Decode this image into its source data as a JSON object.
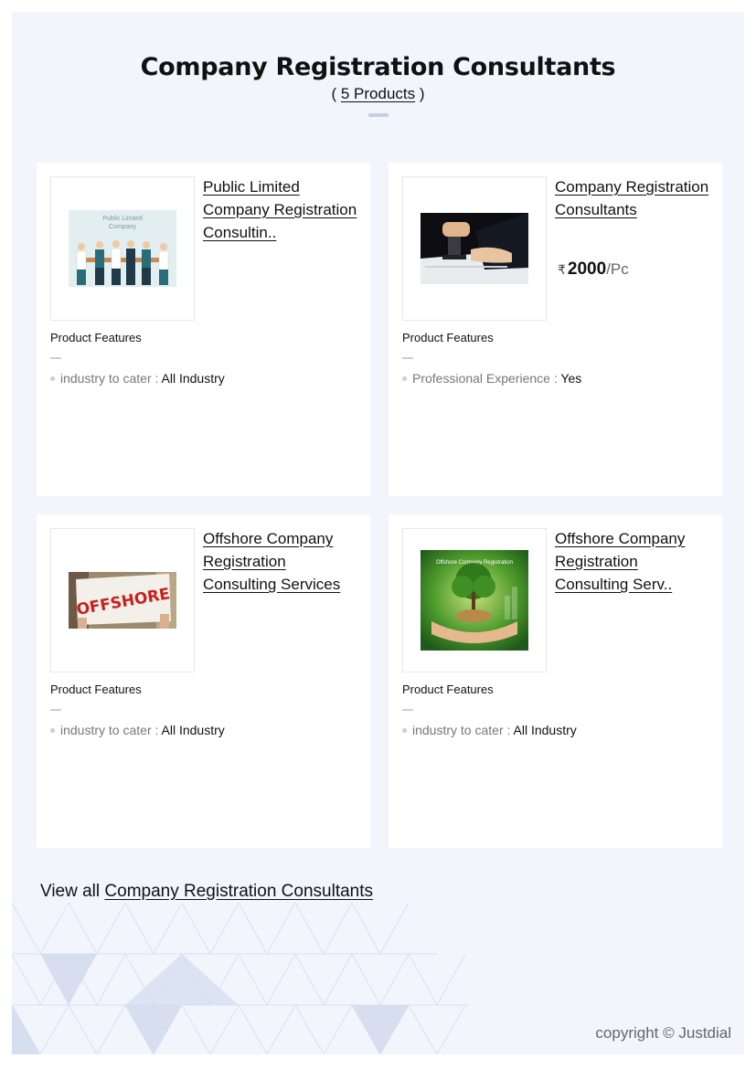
{
  "header": {
    "title": "Company Registration Consultants",
    "count_prefix": "(",
    "count_link": "5 Products",
    "count_suffix": ")"
  },
  "products": [
    {
      "name": "Public Limited Company Registration Consultin..",
      "image_caption": "Public Limited Company",
      "features_title": "Product Features",
      "feature_key": "industry to cater :",
      "feature_value": "All Industry"
    },
    {
      "name": "Company Registration Consultants",
      "price_symbol": "₹",
      "price": "2000",
      "price_unit": "/Pc",
      "features_title": "Product Features",
      "feature_key": "Professional Experience :",
      "feature_value": "Yes"
    },
    {
      "name": "Offshore Company Registration Consulting Services",
      "image_caption": "OFFSHORE",
      "features_title": "Product Features",
      "feature_key": "industry to cater :",
      "feature_value": "All Industry"
    },
    {
      "name": "Offshore Company Registration Consulting Serv..",
      "image_caption": "Offshore Company Registration",
      "features_title": "Product Features",
      "feature_key": "industry to cater :",
      "feature_value": "All Industry"
    }
  ],
  "footer": {
    "view_all_prefix": "View all",
    "view_all_link": "Company Registration Consultants",
    "copyright": "copyright © Justdial"
  },
  "colors": {
    "page_bg": "#f2f5fb",
    "card_bg": "#ffffff",
    "accent_light": "#c6cde8"
  }
}
